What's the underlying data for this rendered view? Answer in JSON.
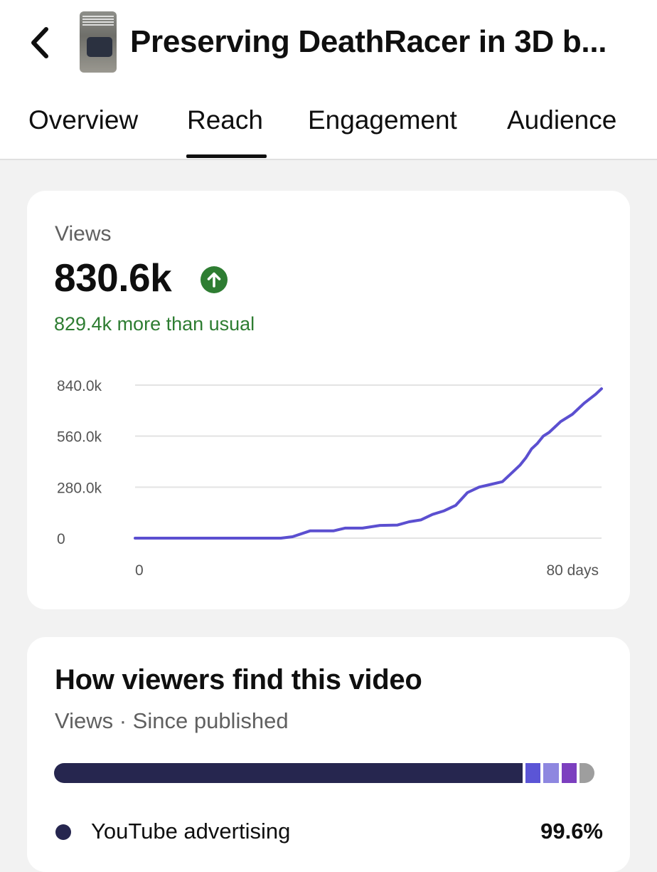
{
  "header": {
    "title": "Preserving DeathRacer in 3D b..."
  },
  "tabs": [
    {
      "label": "Overview"
    },
    {
      "label": "Reach",
      "active": true
    },
    {
      "label": "Engagement"
    },
    {
      "label": "Audience"
    }
  ],
  "views_card": {
    "label": "Views",
    "value": "830.6k",
    "trend_icon": "arrow-up-circle-icon",
    "delta_text": "829.4k more than usual",
    "delta_color": "#2e7d32"
  },
  "chart_data": {
    "type": "line",
    "y_tick_labels": [
      "840.0k",
      "560.0k",
      "280.0k",
      "0"
    ],
    "y_ticks": [
      840000,
      560000,
      280000,
      0
    ],
    "ylim": [
      0,
      840000
    ],
    "x_tick_labels": [
      "0",
      "80 days"
    ],
    "xlim": [
      0,
      80
    ],
    "grid": true,
    "series": [
      {
        "color": "#5b4fd0",
        "x": [
          0,
          25,
          27,
          30,
          34,
          36,
          39,
          42,
          45,
          47,
          49,
          51,
          53,
          55,
          57,
          59,
          61,
          63,
          65,
          66,
          67,
          68,
          69,
          70,
          71,
          72,
          73,
          75,
          77,
          79,
          80
        ],
        "y": [
          0,
          0,
          8000,
          40000,
          40000,
          55000,
          55000,
          70000,
          72000,
          90000,
          100000,
          130000,
          150000,
          180000,
          250000,
          280000,
          295000,
          310000,
          370000,
          400000,
          440000,
          490000,
          520000,
          560000,
          580000,
          610000,
          640000,
          680000,
          740000,
          790000,
          820000
        ]
      }
    ]
  },
  "traffic_card": {
    "title": "How viewers find this video",
    "subtitle": "Views · Since published",
    "segments": [
      {
        "share": 0.872,
        "color": "#26264f"
      },
      {
        "share": 0.028,
        "color": "#5b55d6"
      },
      {
        "share": 0.028,
        "color": "#8e87e0"
      },
      {
        "share": 0.028,
        "color": "#7c3fbf"
      },
      {
        "share": 0.028,
        "color": "#9e9e9e"
      }
    ],
    "legend": [
      {
        "label": "YouTube advertising",
        "value": "99.6%",
        "color": "#26264f"
      }
    ]
  }
}
